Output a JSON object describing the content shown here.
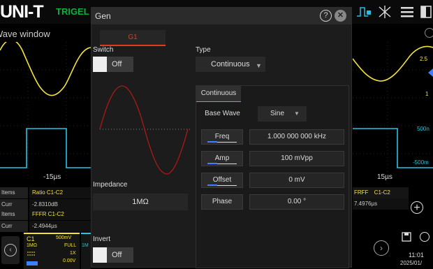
{
  "topbar": {
    "logo_main": "UNI-T",
    "logo_sub": "TRIGEL",
    "icons": [
      "wave-trigger-icon",
      "measure-icon",
      "menu-icon",
      "layout-icon"
    ]
  },
  "scope": {
    "window_label": "Wave window",
    "left_time_label": "-15µs",
    "right_time_label": "15µs",
    "right_scale_1": "2.5",
    "right_scale_2": "1",
    "right_scale_3": "500n",
    "right_scale_4": "-500m",
    "measurements_left": [
      {
        "key": "Items",
        "val": "Ratio  C1-C2"
      },
      {
        "key": "Curr",
        "val": "-2.8310dB"
      },
      {
        "key": "Items",
        "val": "FFFR  C1-C2"
      },
      {
        "key": "Curr",
        "val": "-2.4944µs"
      }
    ],
    "measurements_right": [
      {
        "key": "FRFF",
        "val": "C1-C2"
      },
      {
        "key": "7.4976µs",
        "val": ""
      }
    ],
    "channel_card": {
      "name": "C1",
      "scale": "500mV",
      "impedance": "1MΩ",
      "bw": "FULL",
      "probe": "1X",
      "offset": "0.00V",
      "next": "1M"
    },
    "clock_time": "11:01",
    "clock_date": "2025/01/"
  },
  "dialog": {
    "title": "Gen",
    "help": "?",
    "close": "✕",
    "channel_tab": "G1",
    "switch_label": "Switch",
    "switch_value": "Off",
    "type_label": "Type",
    "type_value": "Continuous",
    "panel_tab": "Continuous",
    "base_wave_label": "Base Wave",
    "base_wave_value": "Sine",
    "freq_label": "Freq",
    "freq_value": "1.000 000 000 kHz",
    "amp_label": "Amp",
    "amp_value": "100 mVpp",
    "offset_label": "Offset",
    "offset_value": "0 mV",
    "phase_label": "Phase",
    "phase_value": "0.00 °",
    "impedance_label": "Impedance",
    "impedance_value": "1MΩ",
    "invert_label": "Invert",
    "invert_value": "Off"
  },
  "colors": {
    "accent_red": "#e33b1e",
    "accent_blue": "#3f80ff",
    "ch1_yellow": "#f4e23a",
    "ch2_cyan": "#22c6e6",
    "preview_wave": "#b01818"
  }
}
